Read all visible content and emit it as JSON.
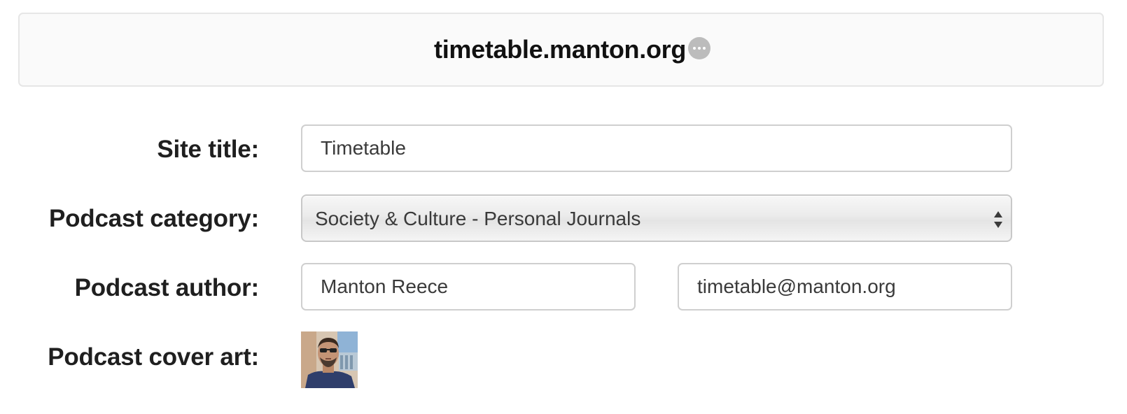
{
  "header": {
    "site_name": "timetable.manton.org",
    "more_icon": "ellipsis-icon"
  },
  "form": {
    "site_title": {
      "label": "Site title:",
      "value": "Timetable"
    },
    "podcast_category": {
      "label": "Podcast category:",
      "selected": "Society & Culture - Personal Journals",
      "icon": "select-arrows-icon"
    },
    "podcast_author": {
      "label": "Podcast author:",
      "name_value": "Manton Reece",
      "email_value": "timetable@manton.org"
    },
    "cover_art": {
      "label": "Podcast cover art:",
      "image": "author-photo"
    }
  },
  "colors": {
    "header_background": "#fafafa",
    "header_border": "#e6e6e6",
    "field_border": "#cfcfcf",
    "more_button": "#bcbcbc"
  }
}
